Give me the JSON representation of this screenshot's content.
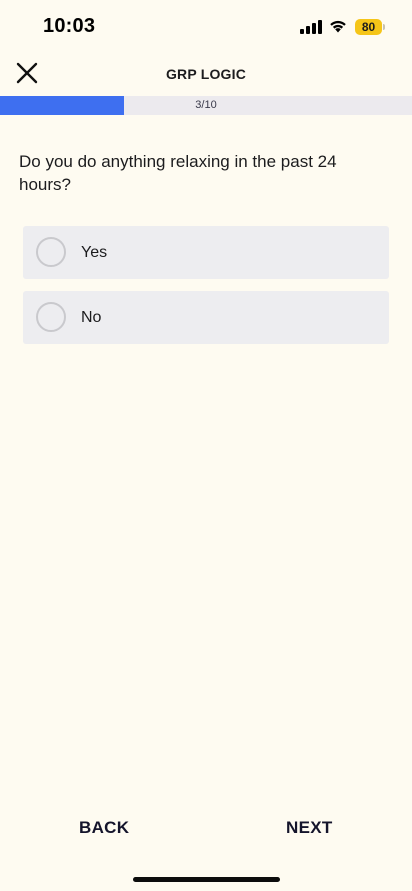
{
  "status_bar": {
    "time": "10:03",
    "battery_level": "80",
    "icons": [
      "signal-icon",
      "wifi-icon",
      "battery-icon"
    ]
  },
  "header": {
    "title": "GRP LOGIC",
    "close_icon": "close-icon"
  },
  "progress": {
    "text": "3/10",
    "fraction": 0.3,
    "fill_color": "#3e6ff0",
    "track_color": "#eceaee"
  },
  "question": {
    "text": "Do you do anything relaxing in the past 24 hours?"
  },
  "options": [
    {
      "label": "Yes",
      "selected": false
    },
    {
      "label": "No",
      "selected": false
    }
  ],
  "footer": {
    "back_label": "BACK",
    "next_label": "NEXT"
  },
  "colors": {
    "background": "#fefbf1",
    "option_background": "#ededf0",
    "battery": "#f5c518"
  }
}
